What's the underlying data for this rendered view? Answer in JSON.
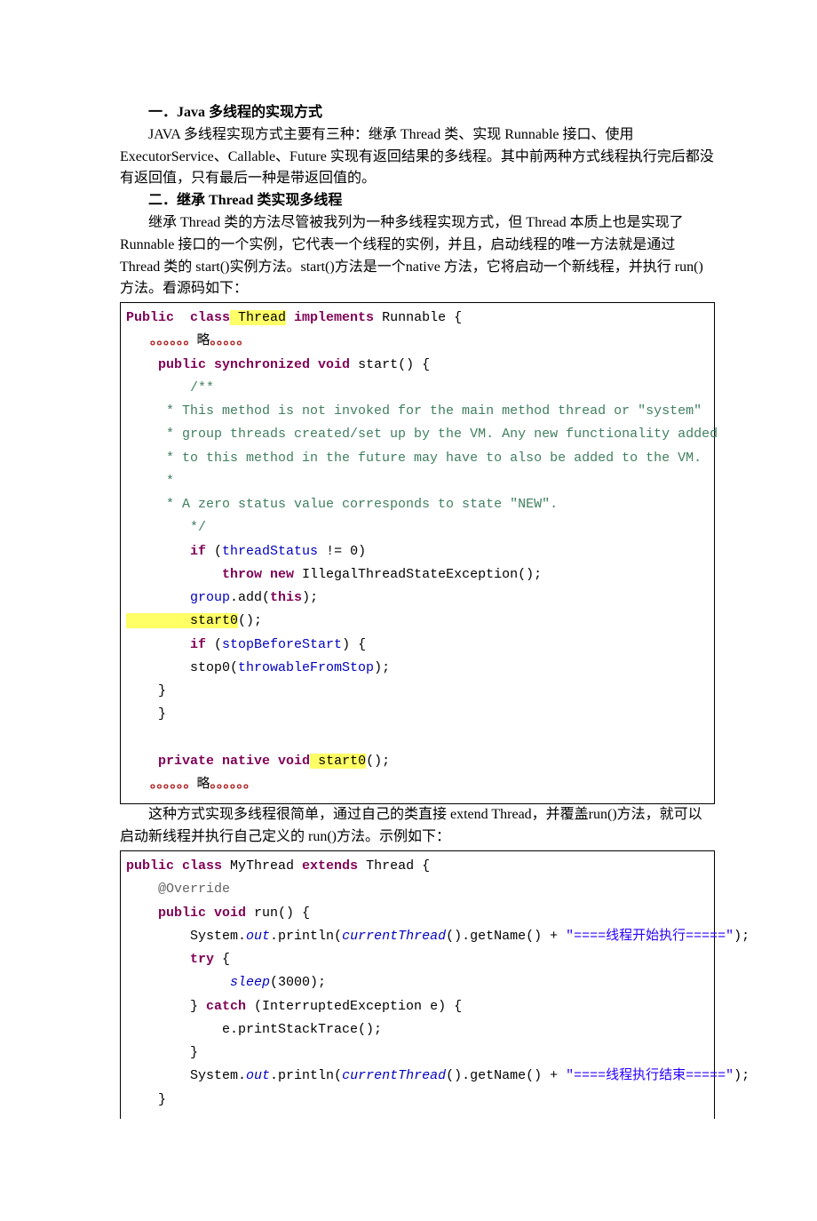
{
  "h1": {
    "num": "一．",
    "latin": "Java",
    "rest": " 多线程的实现方式"
  },
  "p1": "JAVA 多线程实现方式主要有三种：继承 Thread 类、实现 Runnable 接口、使用 ExecutorService、Callable、Future 实现有返回结果的多线程。其中前两种方式线程执行完后都没有返回值，只有最后一种是带返回值的。",
  "h2": {
    "num": "二．继承 ",
    "latin": "Thread",
    "rest": " 类实现多线程"
  },
  "p2": "继承 Thread 类的方法尽管被我列为一种多线程实现方式，但 Thread 本质上也是实现了 Runnable 接口的一个实例，它代表一个线程的实例，并且，启动线程的唯一方法就是通过 Thread 类的 start()实例方法。start()方法是一个native 方法，它将启动一个新线程，并执行 run()方法。看源码如下：",
  "code1": {
    "l1a": "Public",
    "l1b": "  class",
    "l1c": " Thread",
    "l1d": " implements",
    "l1e": " Runnable {",
    "l2a": "   。。。。。。",
    "l2b": "略",
    "l2c": "。。。。。",
    "l3a": "    public",
    "l3b": " synchronized",
    "l3c": " void",
    "l3d": " start() {",
    "l4": "        /**",
    "l5": "     * This method is not invoked for the main method thread or \"system\"",
    "l6": "     * group threads created/set up by the VM. Any new functionality added",
    "l7": "     * to this method in the future may have to also be added to the VM.",
    "l8": "     *",
    "l9": "     * A zero status value corresponds to state \"NEW\".",
    "l10": "        */",
    "l11a": "        if",
    "l11b": " (",
    "l11c": "threadStatus",
    "l11d": " != 0)",
    "l12a": "            throw",
    "l12b": " new",
    "l12c": " IllegalThreadStateException();",
    "l13a": "        group",
    "l13b": ".add(",
    "l13c": "this",
    "l13d": ");",
    "l14a": "        start0",
    "l14b": "();",
    "l15a": "        if",
    "l15b": " (",
    "l15c": "stopBeforeStart",
    "l15d": ") {",
    "l16a": "        stop0(",
    "l16b": "throwableFromStop",
    "l16c": ");",
    "l17": "    }",
    "l18": "    }",
    "blank": "",
    "l19a": "    private",
    "l19b": " native",
    "l19c": " void",
    "l19d": " start0",
    "l19e": "();",
    "l20a": "   。。。。。。",
    "l20b": "略",
    "l20c": "。。。。。。"
  },
  "p3": "这种方式实现多线程很简单，通过自己的类直接 extend Thread，并覆盖run()方法，就可以启动新线程并执行自己定义的 run()方法。示例如下：",
  "code2": {
    "l1a": "public",
    "l1b": " class",
    "l1c": " MyThread ",
    "l1d": "extends",
    "l1e": " Thread {",
    "l2": "    @Override",
    "l3a": "    public",
    "l3b": " void",
    "l3c": " run() {",
    "l4a": "        System.",
    "l4b": "out",
    "l4c": ".println(",
    "l4d": "currentThread",
    "l4e": "().getName() + ",
    "l4f": "\"====线程开始执行=====\"",
    "l4g": ");",
    "l5a": "        try",
    "l5b": " {",
    "l6a": "             sleep",
    "l6b": "(3000);",
    "l7a": "        } ",
    "l7b": "catch",
    "l7c": " (InterruptedException e) {",
    "l8": "            e.printStackTrace();",
    "l9": "        }",
    "l10a": "        System.",
    "l10b": "out",
    "l10c": ".println(",
    "l10d": "currentThread",
    "l10e": "().getName() + ",
    "l10f": "\"====线程执行结束=====\"",
    "l10g": ");",
    "l11": "    }"
  }
}
